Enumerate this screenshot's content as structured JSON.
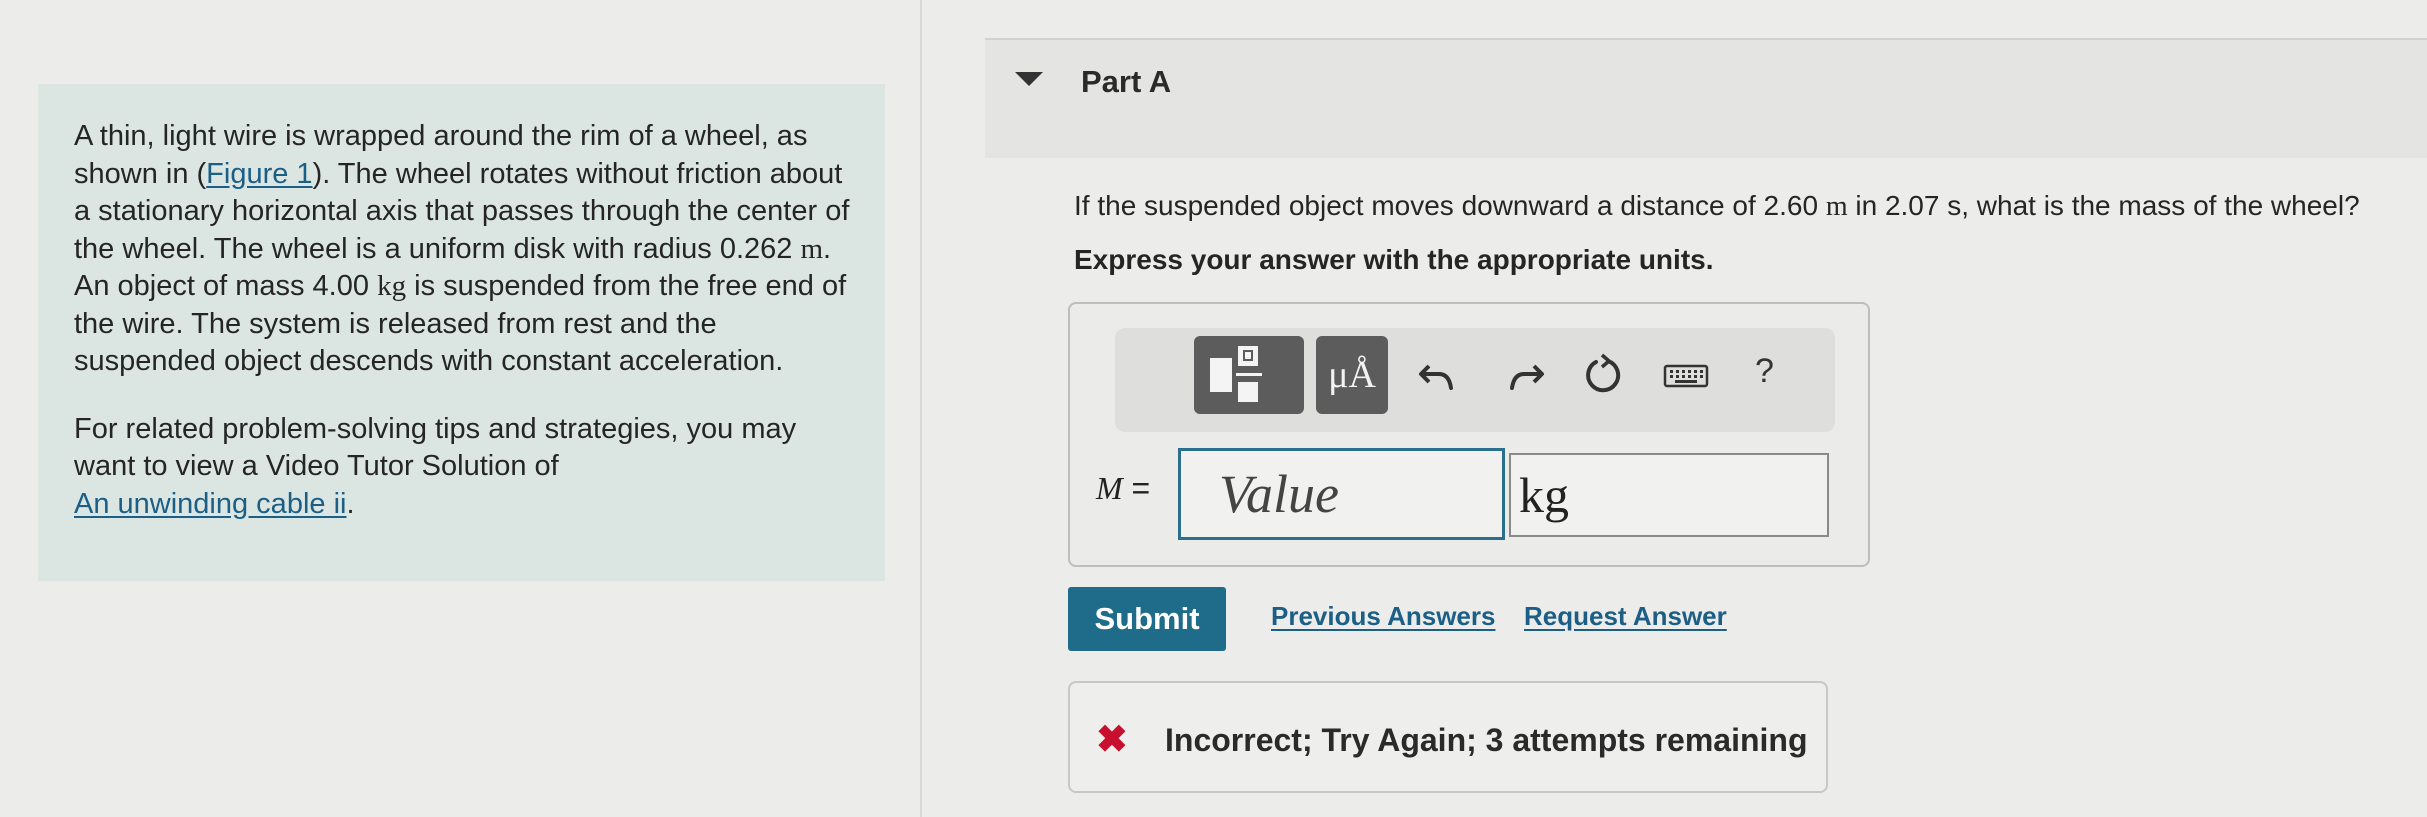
{
  "problem": {
    "p1_a": "A thin, light wire is wrapped around the rim of a wheel, as shown in (",
    "p1_figure_link": "Figure 1",
    "p1_b": "). The wheel rotates without friction about a stationary horizontal axis that passes through the center of the wheel. The wheel is a uniform disk with radius 0.262 ",
    "p1_unit_m": "m",
    "p1_c": ". An object of mass 4.00 ",
    "p1_unit_kg": "kg",
    "p1_d": " is suspended from the free end of the wire. The system is released from rest and the suspended object descends with constant acceleration.",
    "p2_a": "For related problem-solving tips and strategies, you may want to view a Video Tutor Solution of",
    "p2_link": "An unwinding cable ii",
    "p2_b": "."
  },
  "part": {
    "title": "Part A"
  },
  "question": {
    "q_a": "If the suspended object moves downward a distance of 2.60 ",
    "q_unit_m": "m",
    "q_b": " in 2.07 s, what is the mass of the wheel?",
    "instruction": "Express your answer with the appropriate units."
  },
  "toolbar": {
    "units_label": "μÅ",
    "help_label": "?"
  },
  "answer": {
    "variable": "M",
    "equals": " =",
    "value_placeholder": "Value",
    "unit_value": "kg"
  },
  "actions": {
    "submit_label": "Submit",
    "previous_answers_label": "Previous Answers",
    "request_answer_label": "Request Answer"
  },
  "feedback": {
    "icon": "✖",
    "message": "Incorrect; Try Again; 3 attempts remaining"
  },
  "colors": {
    "accent": "#1f6b8a",
    "error": "#c8102e",
    "panel": "#dbe6e2"
  }
}
